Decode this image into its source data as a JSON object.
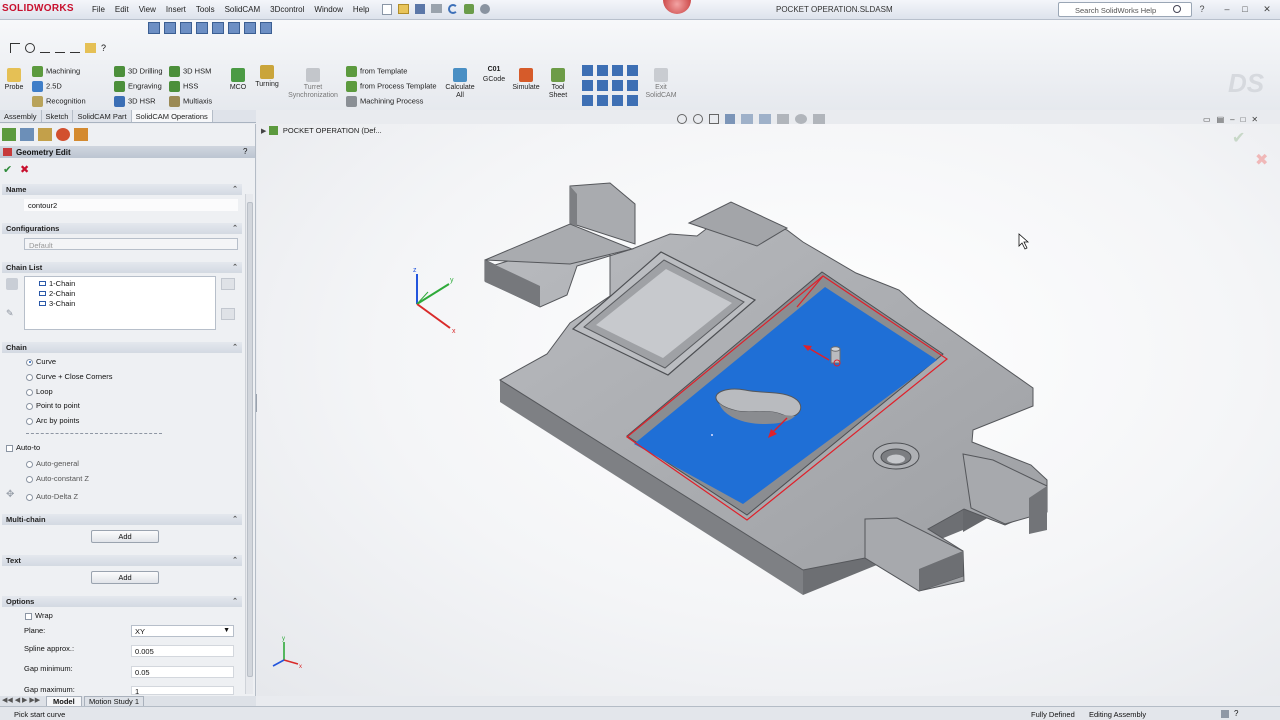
{
  "app": {
    "logo": "SOLIDWORKS",
    "document_title": "POCKET OPERATION.SLDASM",
    "help_search_placeholder": "Search SolidWorks Help"
  },
  "menu": [
    "File",
    "Edit",
    "View",
    "Insert",
    "Tools",
    "SolidCAM",
    "3Dcontrol",
    "Window",
    "Help"
  ],
  "cmd": {
    "probe": "Probe",
    "machining": "Machining",
    "d25": "2.5D",
    "recognition": "Recognition",
    "drilling3d": "3D Drilling",
    "engraving": "Engraving",
    "hsr3d": "3D HSR",
    "hsm3d": "3D HSM",
    "hss": "HSS",
    "multiaxis": "Multiaxis",
    "mco": "MCO",
    "turning": "Turning",
    "turret_line1": "Turret",
    "turret_line2": "Synchronization",
    "from_template": "from Template",
    "from_process_template": "from Process Template",
    "machining_process": "Machining Process",
    "calc_line1": "Calculate",
    "calc_line2": "All",
    "gcode_top": "C01",
    "gcode": "GCode",
    "simulate": "Simulate",
    "toolsheet_line1": "Tool",
    "toolsheet_line2": "Sheet",
    "exit_line1": "Exit",
    "exit_line2": "SolidCAM"
  },
  "tabs": [
    "Assembly",
    "Sketch",
    "SolidCAM Part",
    "SolidCAM Operations"
  ],
  "panel": {
    "title": "Geometry Edit",
    "help": "?",
    "name_header": "Name",
    "name_value": "contour2",
    "config_header": "Configurations",
    "config_value": "Default",
    "chainlist_header": "Chain List",
    "chains": [
      "1-Chain",
      "2-Chain",
      "3-Chain"
    ],
    "chain_header": "Chain",
    "chain_options": [
      "Curve",
      "Curve + Close Corners",
      "Loop",
      "Point to point",
      "Arc by points"
    ],
    "autoto": "Auto-to",
    "auto_options": [
      "Auto-general",
      "Auto-constant Z",
      "Auto-Delta Z"
    ],
    "multichain_header": "Multi-chain",
    "add": "Add",
    "text_header": "Text",
    "options_header": "Options",
    "wrap": "Wrap",
    "plane_label": "Plane:",
    "plane_value": "XY",
    "spline_label": "Spline approx.:",
    "spline_value": "0.005",
    "gapmin_label": "Gap minimum:",
    "gapmin_value": "0.05",
    "gapmax_label": "Gap maximum:",
    "gapmax_value": "1"
  },
  "viewport": {
    "tree_label": "POCKET OPERATION  (Def..."
  },
  "bottom_tabs": [
    "Model",
    "Motion Study 1"
  ],
  "status": {
    "hint": "Pick start curve",
    "fully": "Fully Defined",
    "editing": "Editing Assembly"
  },
  "colors": {
    "accent": "#1f5fbf",
    "pocket": "#1f6fd6",
    "body": "#a7a9ad",
    "chain": "#e0202a"
  }
}
